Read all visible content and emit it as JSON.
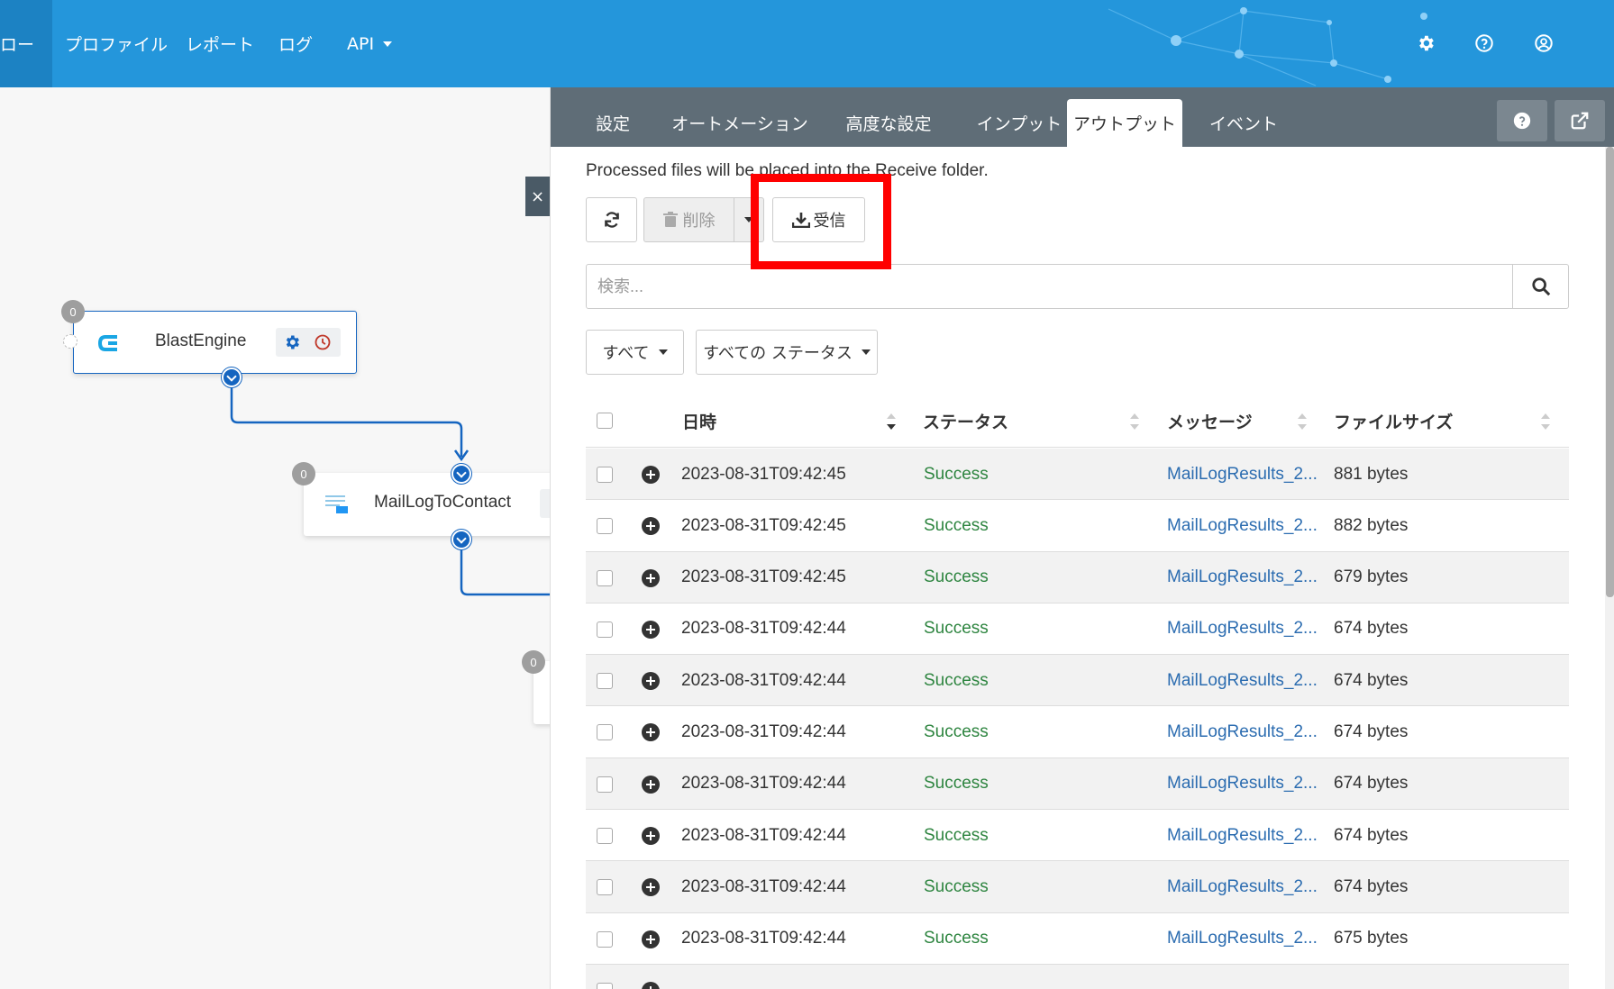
{
  "nav": {
    "items": [
      {
        "label": "ロー",
        "active": true
      },
      {
        "label": "プロファイル"
      },
      {
        "label": "レポート"
      },
      {
        "label": "ログ"
      },
      {
        "label": "API"
      }
    ],
    "icons": [
      "gear-icon",
      "help-icon",
      "user-icon"
    ],
    "color": "#2496db"
  },
  "flow": {
    "nodes": [
      {
        "label": "BlastEngine",
        "count": "0"
      },
      {
        "label": "MailLogToContact",
        "count": "0"
      },
      {
        "label": "",
        "count": "0"
      }
    ],
    "close_label": "×"
  },
  "panel": {
    "tabs": [
      "設定",
      "オートメーション",
      "高度な設定",
      "インプット",
      "アウトプット",
      "イベント"
    ],
    "active_tab": "アウトプット",
    "info": "Processed files will be placed into the  Receive folder.",
    "toolbar": {
      "delete_label": "削除",
      "receive_label": "受信"
    },
    "search": {
      "placeholder": "検索..."
    },
    "filters": {
      "all_label": "すべて",
      "status_label": "すべての ステータス"
    },
    "table": {
      "headers": [
        "日時",
        "ステータス",
        "メッセージ",
        "ファイルサイズ"
      ],
      "rows": [
        {
          "date": "2023-08-31T09:42:45",
          "status": "Success",
          "message": "MailLogResults_2...",
          "size": "881 bytes"
        },
        {
          "date": "2023-08-31T09:42:45",
          "status": "Success",
          "message": "MailLogResults_2...",
          "size": "882 bytes"
        },
        {
          "date": "2023-08-31T09:42:45",
          "status": "Success",
          "message": "MailLogResults_2...",
          "size": "679 bytes"
        },
        {
          "date": "2023-08-31T09:42:44",
          "status": "Success",
          "message": "MailLogResults_2...",
          "size": "674 bytes"
        },
        {
          "date": "2023-08-31T09:42:44",
          "status": "Success",
          "message": "MailLogResults_2...",
          "size": "674 bytes"
        },
        {
          "date": "2023-08-31T09:42:44",
          "status": "Success",
          "message": "MailLogResults_2...",
          "size": "674 bytes"
        },
        {
          "date": "2023-08-31T09:42:44",
          "status": "Success",
          "message": "MailLogResults_2...",
          "size": "674 bytes"
        },
        {
          "date": "2023-08-31T09:42:44",
          "status": "Success",
          "message": "MailLogResults_2...",
          "size": "674 bytes"
        },
        {
          "date": "2023-08-31T09:42:44",
          "status": "Success",
          "message": "MailLogResults_2...",
          "size": "674 bytes"
        },
        {
          "date": "2023-08-31T09:42:44",
          "status": "Success",
          "message": "MailLogResults_2...",
          "size": "675 bytes"
        }
      ]
    },
    "colors": {
      "success": "#2e8540",
      "link": "#2b6cb0",
      "highlight": "#ff0000"
    }
  }
}
